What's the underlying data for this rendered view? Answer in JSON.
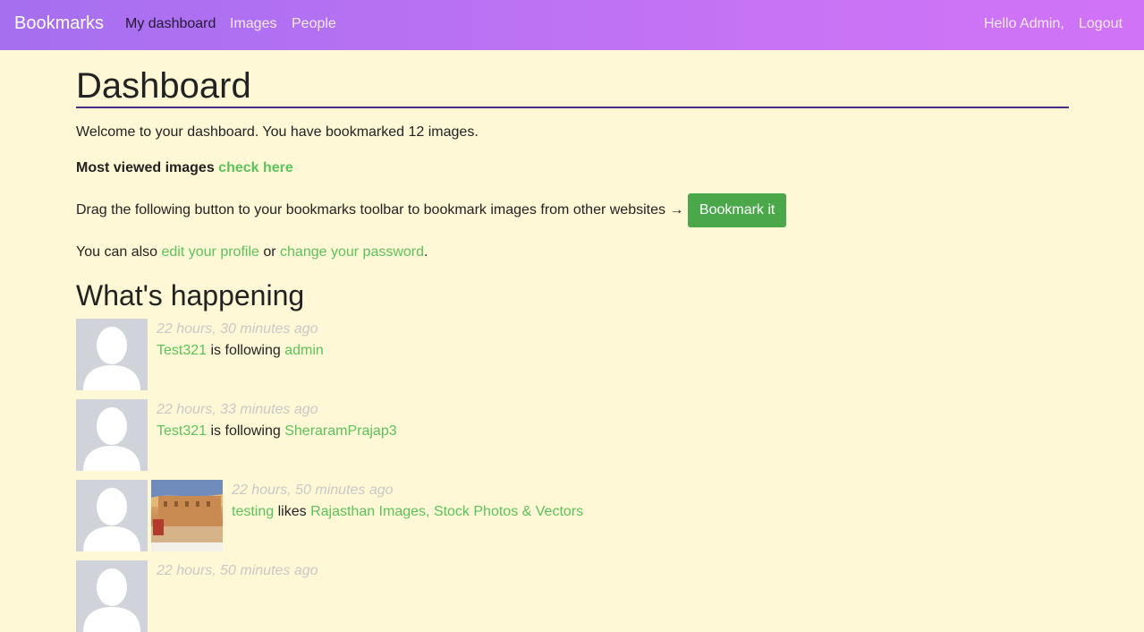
{
  "nav": {
    "brand": "Bookmarks",
    "links": [
      {
        "label": "My dashboard"
      },
      {
        "label": "Images"
      },
      {
        "label": "People"
      }
    ],
    "greeting": "Hello Admin,",
    "logout": "Logout"
  },
  "page": {
    "title": "Dashboard",
    "welcome": "Welcome to your dashboard. You have bookmarked 12 images.",
    "most_viewed_label": "Most viewed images",
    "most_viewed_link": "check here",
    "drag_text": "Drag the following button to your bookmarks toolbar to bookmark images from other websites →",
    "bookmark_button": "Bookmark it",
    "also_prefix": "You can also",
    "edit_profile": "edit your profile",
    "or_text": "or",
    "change_password": "change your password",
    "period": ".",
    "happening_title": "What's happening"
  },
  "actions": [
    {
      "time": "22 hours, 30 minutes ago",
      "user": "Test321",
      "verb": "is following",
      "target": "admin"
    },
    {
      "time": "22 hours, 33 minutes ago",
      "user": "Test321",
      "verb": "is following",
      "target": "SheraramPrajap3"
    },
    {
      "time": "22 hours, 50 minutes ago",
      "user": "testing",
      "verb": "likes",
      "target": "Rajasthan Images, Stock Photos & Vectors"
    },
    {
      "time": "22 hours, 50 minutes ago"
    }
  ],
  "colors": {
    "background": "#fff8d6",
    "nav_gradient_start": "#a56ff0",
    "nav_gradient_end": "#d173f6",
    "link_green": "#5bc35b",
    "button_green": "#4aa74a"
  }
}
